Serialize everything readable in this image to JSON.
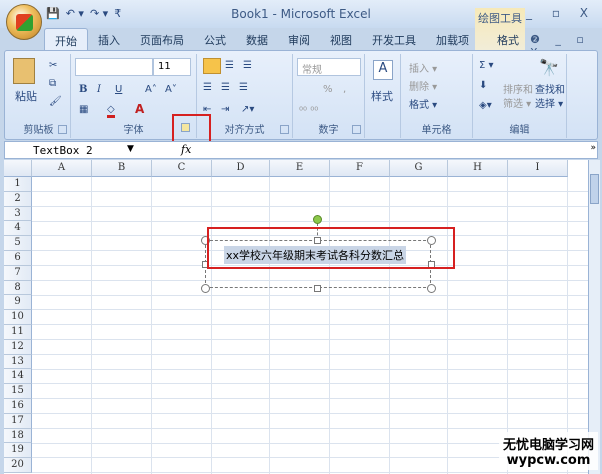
{
  "window": {
    "title": "Book1 - Microsoft Excel",
    "context_tool": "绘图工具",
    "controls": "_ ▫ X"
  },
  "qat": {
    "save": "💾",
    "undo": "↶ ▾",
    "redo": "↷ ▾",
    "more": "₹"
  },
  "tabs": [
    "开始",
    "插入",
    "页面布局",
    "公式",
    "数据",
    "审阅",
    "视图",
    "开发工具",
    "加载项",
    "格式"
  ],
  "tab_right": "❷ _ ▫ X",
  "ribbon": {
    "clipboard": {
      "label": "剪贴板",
      "paste": "粘贴"
    },
    "font": {
      "label": "字体",
      "size": "11",
      "bold": "B",
      "italic": "I",
      "underline": "U",
      "grow": "A˄",
      "shrink": "A˅"
    },
    "alignment": {
      "label": "对齐方式"
    },
    "number": {
      "label": "数字",
      "format": "常规",
      "percent": "%",
      "comma": ","
    },
    "styles": {
      "label": "样式"
    },
    "cells": {
      "label": "单元格",
      "insert": "插入 ▾",
      "delete": "删除 ▾",
      "format": "格式 ▾"
    },
    "editing": {
      "label": "编辑",
      "sort": "排序和\n筛选 ▾",
      "find": "查找和\n选择 ▾",
      "sum": "Σ ▾"
    }
  },
  "formula_bar": {
    "name_box": "TextBox 2",
    "fx": "fx",
    "value": ""
  },
  "columns": [
    "A",
    "B",
    "C",
    "D",
    "E",
    "F",
    "G",
    "H",
    "I"
  ],
  "rows": [
    "1",
    "2",
    "3",
    "4",
    "5",
    "6",
    "7",
    "8",
    "9",
    "10",
    "11",
    "12",
    "13",
    "14",
    "15",
    "16",
    "17",
    "18",
    "19",
    "20"
  ],
  "textbox": {
    "text": "xx学校六年级期末考试各科分数汇总"
  },
  "watermark": {
    "line1": "无忧电脑学习网",
    "line2": "wypcw.com"
  }
}
